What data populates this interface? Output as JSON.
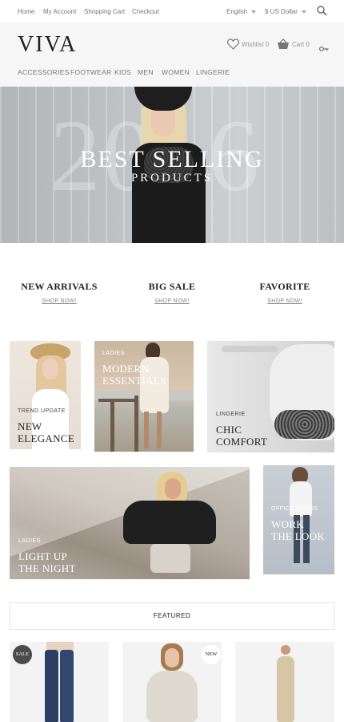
{
  "topbar": {
    "home": "Home",
    "my_account": "My Account",
    "shopping_cart": "Shopping Cart",
    "checkout": "Checkout",
    "language": "English",
    "currency": "$ US Dollar"
  },
  "header": {
    "logo": "VIVA",
    "wishlist": "Wishlist 0",
    "cart": "Cart 0"
  },
  "nav": {
    "items": [
      "ACCESSORIES",
      "FOOTWEAR",
      "KIDS",
      "MEN",
      "WOMEN",
      "LINGERIE"
    ]
  },
  "hero": {
    "year": "2016",
    "title": "BEST SELLING",
    "subtitle": "PRODUCTS"
  },
  "promos": [
    {
      "title": "NEW ARRIVALS",
      "link": "SHOP NOW!"
    },
    {
      "title": "BIG SALE",
      "link": "SHOP NOW!"
    },
    {
      "title": "FAVORITE",
      "link": "SHOP NOW!"
    }
  ],
  "tiles": {
    "trend": {
      "small": "TREND UPDATE",
      "line1": "NEW",
      "line2": "ELEGANCE"
    },
    "ladies_modern": {
      "small": "LADIES",
      "line1": "MODERN",
      "line2": "ESSENTIALS"
    },
    "lingerie": {
      "small": "LINGERIE",
      "line1": "CHIC",
      "line2": "COMFORT"
    },
    "ladies_night": {
      "small": "LADIES",
      "line1": "LIGHT UP",
      "line2": "THE NIGHT"
    },
    "office": {
      "small": "OFFICE HOURS",
      "line1": "WORK",
      "line2": "THE LOOK"
    }
  },
  "featured": {
    "title": "FEATURED",
    "badge_sale": "SALE",
    "badge_new": "NEW"
  },
  "colors": {
    "accent": "#222222",
    "header_bg": "#f6f6f6",
    "badge_sale_bg": "#4a4a4a"
  }
}
